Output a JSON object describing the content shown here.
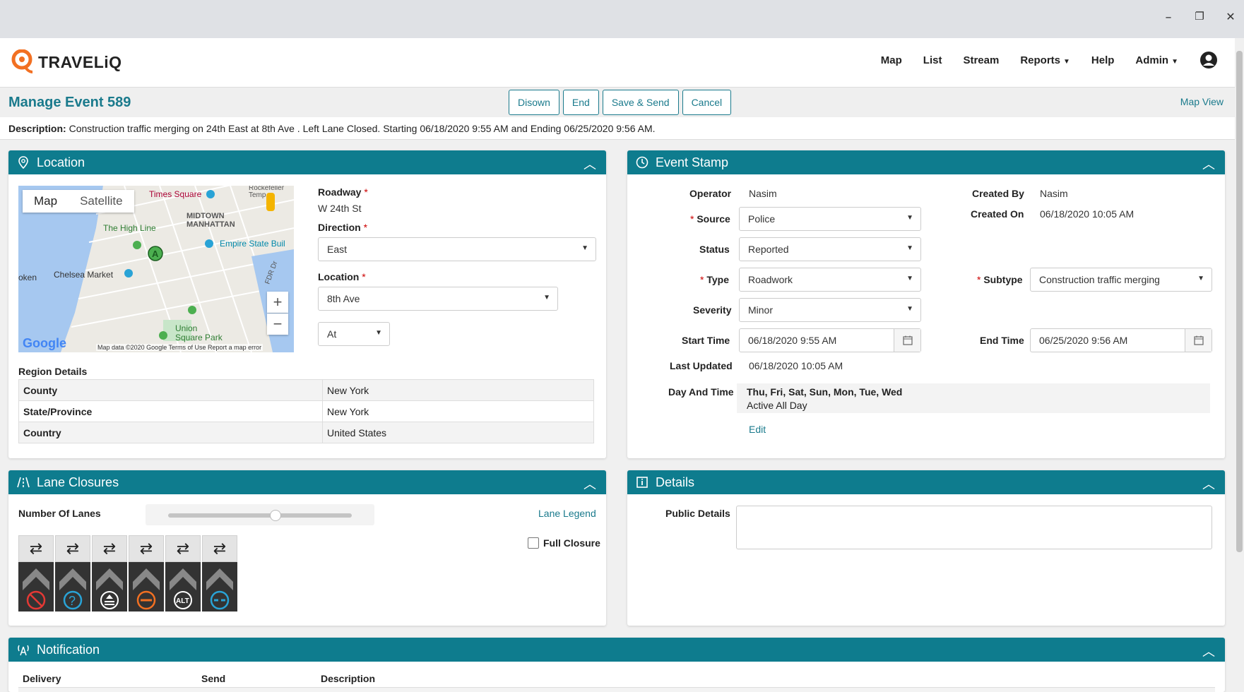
{
  "window": {
    "minimize": "–",
    "restore": "❐",
    "close": "✕"
  },
  "brand": {
    "name": "TRAVELiQ"
  },
  "nav": {
    "items": [
      {
        "label": "Map",
        "caret": false
      },
      {
        "label": "List",
        "caret": false
      },
      {
        "label": "Stream",
        "caret": false
      },
      {
        "label": "Reports",
        "caret": true
      },
      {
        "label": "Help",
        "caret": false
      },
      {
        "label": "Admin",
        "caret": true
      }
    ]
  },
  "header": {
    "title": "Manage Event 589",
    "buttons": {
      "disown": "Disown",
      "end": "End",
      "save_send": "Save & Send",
      "cancel": "Cancel"
    },
    "map_view": "Map View"
  },
  "description": {
    "label": "Description:",
    "text": " Construction traffic merging on 24th East at 8th Ave . Left Lane Closed. Starting 06/18/2020 9:55 AM and Ending 06/25/2020 9:56 AM."
  },
  "location": {
    "title": "Location",
    "map": {
      "tab_map": "Map",
      "tab_satellite": "Satellite",
      "zoom_in": "+",
      "zoom_out": "−",
      "google": "Google",
      "footer": "Map data ©2020 Google   Terms of Use   Report a map error",
      "labels": {
        "times_square": "Times Square",
        "rockefeller": "Rockefeller",
        "temp": "Temp",
        "midtown": "MIDTOWN",
        "manhattan": "MANHATTAN",
        "high_line": "The High Line",
        "empire": "Empire State Buil",
        "chelsea": "Chelsea Market",
        "hoken": "oken",
        "union": "Union",
        "square_park": "Square Park",
        "fdr": "FDR Dr",
        "marker": "A"
      }
    },
    "roadway_label": "Roadway",
    "roadway_value": "W 24th St",
    "direction_label": "Direction",
    "direction_value": "East",
    "location_label": "Location",
    "location_value": "8th Ave",
    "relation_value": "At",
    "region_title": "Region Details",
    "region": [
      {
        "key": "County",
        "value": "New York"
      },
      {
        "key": "State/Province",
        "value": "New York"
      },
      {
        "key": "Country",
        "value": "United States"
      }
    ]
  },
  "event_stamp": {
    "title": "Event Stamp",
    "operator_label": "Operator",
    "operator_value": "Nasim",
    "created_by_label": "Created By",
    "created_by_value": "Nasim",
    "created_on_label": "Created On",
    "created_on_value": "06/18/2020 10:05 AM",
    "source_label": "Source",
    "source_value": "Police",
    "status_label": "Status",
    "status_value": "Reported",
    "type_label": "Type",
    "type_value": "Roadwork",
    "subtype_label": "Subtype",
    "subtype_value": "Construction traffic merging",
    "severity_label": "Severity",
    "severity_value": "Minor",
    "start_label": "Start Time",
    "start_value": "06/18/2020 9:55 AM",
    "end_label": "End Time",
    "end_value": "06/25/2020 9:56 AM",
    "updated_label": "Last Updated",
    "updated_value": "06/18/2020 10:05 AM",
    "day_time_label": "Day And Time",
    "days": "Thu, Fri, Sat, Sun, Mon, Tue, Wed",
    "active": "Active All Day",
    "edit": "Edit"
  },
  "lane_closures": {
    "title": "Lane Closures",
    "lanes_label": "Number Of Lanes",
    "lane_legend": "Lane Legend",
    "full_closure": "Full Closure",
    "lane_top_glyph": "⇄",
    "lanes": [
      {
        "icon": "closed-icon",
        "color": "#e53935"
      },
      {
        "icon": "unknown-icon",
        "color": "#29a3d6"
      },
      {
        "icon": "merge-up-icon",
        "color": "#ffffff"
      },
      {
        "icon": "blocked-icon",
        "color": "#f27022"
      },
      {
        "icon": "alt-icon",
        "color": "#ffffff",
        "text": "ALT"
      },
      {
        "icon": "shoulder-icon",
        "color": "#29a3d6"
      }
    ]
  },
  "details": {
    "title": "Details",
    "public_label": "Public Details"
  },
  "notification": {
    "title": "Notification",
    "cols": [
      "Delivery",
      "Send",
      "Description"
    ]
  },
  "colors": {
    "accent": "#0e7c8e",
    "link": "#1a7a8c"
  }
}
